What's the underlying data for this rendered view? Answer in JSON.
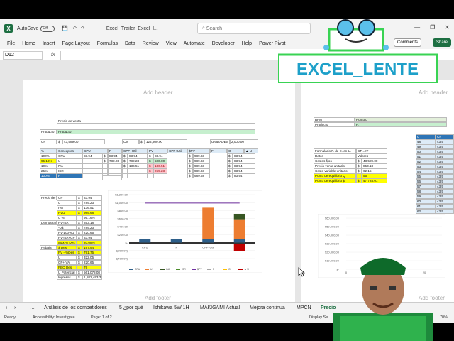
{
  "titlebar": {
    "app_logo": "X",
    "autosave": "AutoSave",
    "autosave_state": "Off",
    "filename": "Excel_Trailer_Excel_l...",
    "search_placeholder": "Search",
    "min": "—",
    "max": "❐",
    "close": "✕"
  },
  "menu": [
    "File",
    "Home",
    "Insert",
    "Page Layout",
    "Formulas",
    "Data",
    "Review",
    "View",
    "Automate",
    "Developer",
    "Help",
    "Power Pivot"
  ],
  "comments": "Comments",
  "share": "Share",
  "formula": {
    "namebox": "D12",
    "fx": "fx"
  },
  "page": {
    "add_header": "Add header",
    "add_footer": "Add footer"
  },
  "sheet": {
    "precio_title": "Precio de venta",
    "producto_label": "Producto",
    "producto_value": "Producto",
    "cf_label": "CF",
    "cf_currency": "$",
    "cf_value": "43,589.00",
    "cv_label": "CV",
    "cv_currency": "$",
    "cv_value": "124,300.00",
    "unidades_label": "UNIDADES",
    "unidades_value": "2,000.00",
    "header_row": [
      "%",
      "Conceptos",
      "CPU",
      "F",
      "CPF+Util",
      "PV",
      "CPF+Util",
      "$PV",
      "F",
      "G",
      "▲ U"
    ],
    "pct": [
      "100%",
      "95.16%",
      "10%",
      "25%",
      "100%"
    ],
    "conceptos": [
      "CPU",
      "U",
      "IVA",
      "ISR",
      "F"
    ],
    "cpu_col": [
      "83.94",
      "",
      "",
      "",
      ""
    ],
    "rows": [
      [
        "$",
        "83.94",
        "$",
        "83.94",
        "$",
        "83.94",
        "$",
        "989.68",
        "$",
        "83.94"
      ],
      [
        "$",
        "789.23",
        "$",
        "789.23",
        "$",
        "500.00",
        "$",
        "989.68",
        "$",
        "83.94"
      ],
      [
        "",
        "",
        "$",
        "136.51",
        "$",
        "136.51",
        "$",
        "989.68",
        "$",
        "83.94"
      ],
      [
        "",
        "",
        "",
        "",
        "$",
        "269.23",
        "$",
        "989.68",
        "$",
        "83.94"
      ],
      [
        "",
        "",
        "",
        "",
        "",
        "",
        "$",
        "989.68",
        "$",
        "83.94"
      ]
    ],
    "left_labels": [
      "Precio de venta",
      "Demostración",
      "Rebaja"
    ],
    "left_rows": [
      [
        "CP",
        "$",
        "83.94"
      ],
      [
        "U",
        "$",
        "789.23"
      ],
      [
        "IVA",
        "$",
        "136.51"
      ],
      [
        "PVU",
        "$",
        "989.68"
      ],
      [
        "U %",
        "",
        "95.16%"
      ],
      [
        "PV-IVA",
        "$",
        "853.18"
      ],
      [
        "-U$",
        "$",
        "789.23"
      ],
      [
        "PV-100%U",
        "$",
        "220.65"
      ],
      [
        "PV-IVA+CP",
        "$",
        "83.94"
      ],
      [
        "Max % Des",
        "",
        "20.08%"
      ],
      [
        "$ Des",
        "$",
        "197.94"
      ],
      [
        "PV - %Des",
        "$",
        "791.75"
      ],
      [
        "U",
        "$",
        "322.05"
      ],
      [
        "CP+IVA",
        "$",
        "220.65"
      ],
      [
        "PEQ Des",
        "",
        "79"
      ],
      [
        "U Potencial",
        "$",
        "561,078.08"
      ],
      [
        "Ingresos",
        "$",
        "1,582,493.36"
      ]
    ],
    "right_block": {
      "bpm": "BPM",
      "producto": "Producto",
      "punto": "Punto d",
      "p_val": "P.",
      "header1": "Formulario P. de E. en U.",
      "header2": "CT = IT",
      "datos": "Datos",
      "valores": "Valores",
      "rows": [
        [
          "Costos fijos",
          "$",
          "43,589.00"
        ],
        [
          "Precio venta unitario",
          "$",
          "853.18"
        ],
        [
          "Costo variable unitario",
          "$",
          "62.15"
        ],
        [
          "Punto de equilibrio Q",
          "",
          "55"
        ],
        [
          "Punto de equilibrio $",
          "$",
          "47,728.01"
        ]
      ]
    },
    "u_col": {
      "header_u": "U",
      "header_cf": "CF",
      "u": [
        "48",
        "49",
        "50",
        "51",
        "52",
        "53",
        "54",
        "55",
        "56",
        "57",
        "58",
        "59",
        "60",
        "61",
        "62"
      ],
      "cf": [
        "43,5",
        "43,5",
        "43,5",
        "43,5",
        "43,5",
        "43,5",
        "43,5",
        "43,5",
        "43,5",
        "43,5",
        "43,5",
        "43,5",
        "43,5",
        "43,5",
        "43,5"
      ]
    }
  },
  "chart_data": [
    {
      "type": "bar",
      "categories": [
        "CPU",
        "F",
        "CPF+Util",
        "PV"
      ],
      "yticks": [
        "$1,200.00",
        "$1,000.00",
        "$800.00",
        "$600.00",
        "$400.00",
        "$200.00",
        "$-",
        "$(200.00)",
        "$(400.00)"
      ],
      "ylim": [
        -400,
        1200
      ],
      "series": [
        {
          "name": "CPU",
          "values": [
            83.94,
            83.94,
            83.94,
            83.94
          ]
        },
        {
          "name": "U",
          "values": [
            0,
            0,
            789.23,
            500
          ]
        },
        {
          "name": "IVA",
          "values": [
            0,
            0,
            0,
            136.51
          ]
        }
      ],
      "legend": [
        "CPU",
        "U",
        "IVA",
        "ISR",
        "$PV",
        "F",
        "G",
        "▲ U"
      ],
      "legend_colors": [
        "#2e5f8a",
        "#ed7d31",
        "#375623",
        "#4a8c2a",
        "#7030a0",
        "#a5a5a5",
        "#ffc000",
        "#c00000"
      ]
    },
    {
      "type": "line",
      "yticks": [
        "$60,000.00",
        "$50,000.00",
        "$40,000.00",
        "$30,000.00",
        "$20,000.00",
        "$10,000.00",
        "$-"
      ],
      "xticks": [
        "0",
        "20"
      ]
    }
  ],
  "tabs": [
    "Análisis de los competidores",
    "5 ¿por qué",
    "Ishikawa 5W 1H",
    "MAKIGAMI Actual",
    "Mejora continua",
    "MPCN",
    "Precio"
  ],
  "status": {
    "ready": "Ready",
    "accessibility": "Accessibility: Investigate",
    "page": "Page: 1 of 2",
    "display": "Display Se",
    "zoom": "70%"
  },
  "logo_text": "EXCEL_LENTE"
}
